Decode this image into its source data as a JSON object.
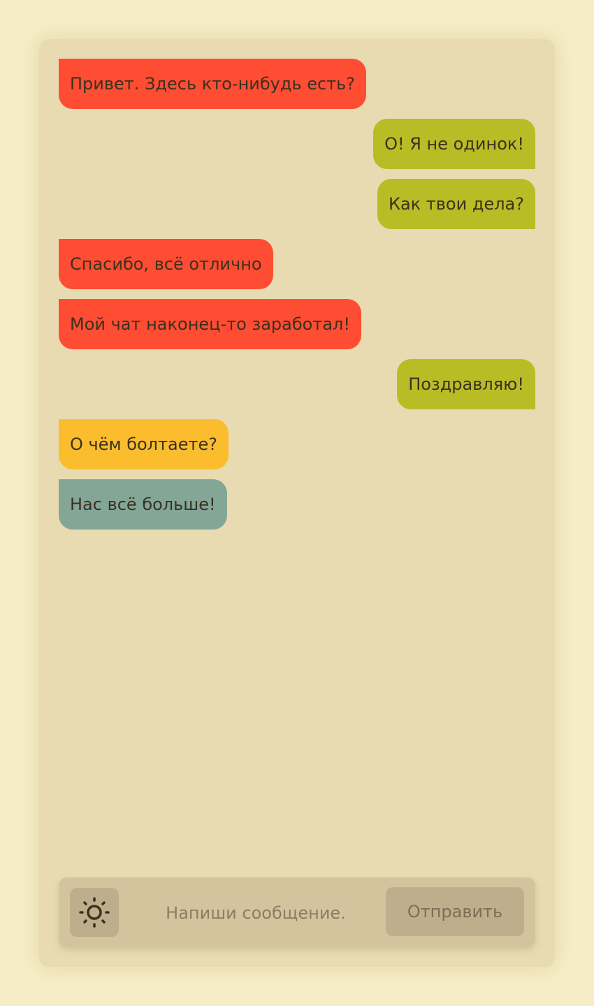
{
  "messages": [
    {
      "text": "Привет. Здесь кто-нибудь есть?",
      "side": "in",
      "color": "#ff4d33"
    },
    {
      "text": "О! Я не одинок!",
      "side": "out",
      "color": "#b9bd25"
    },
    {
      "text": "Как твои дела?",
      "side": "out",
      "color": "#b9bd25"
    },
    {
      "text": "Спасибо, всё отлично",
      "side": "in",
      "color": "#ff4d33"
    },
    {
      "text": "Мой чат наконец-то заработал!",
      "side": "in",
      "color": "#ff4d33"
    },
    {
      "text": "Поздравляю!",
      "side": "out",
      "color": "#b9bd25"
    },
    {
      "text": "О чём болтаете?",
      "side": "in",
      "color": "#fbbd2e"
    },
    {
      "text": "Нас всё больше!",
      "side": "in",
      "color": "#83a697"
    }
  ],
  "input": {
    "placeholder": "Напиши сообщение.",
    "value": ""
  },
  "send_button": {
    "label": "Отправить"
  },
  "theme_button": {
    "icon": "sun-icon"
  },
  "colors": {
    "background": "#f6edc6",
    "panel": "#e8dbb2",
    "input_bar": "#d4c49e",
    "button": "#bfae8b"
  }
}
